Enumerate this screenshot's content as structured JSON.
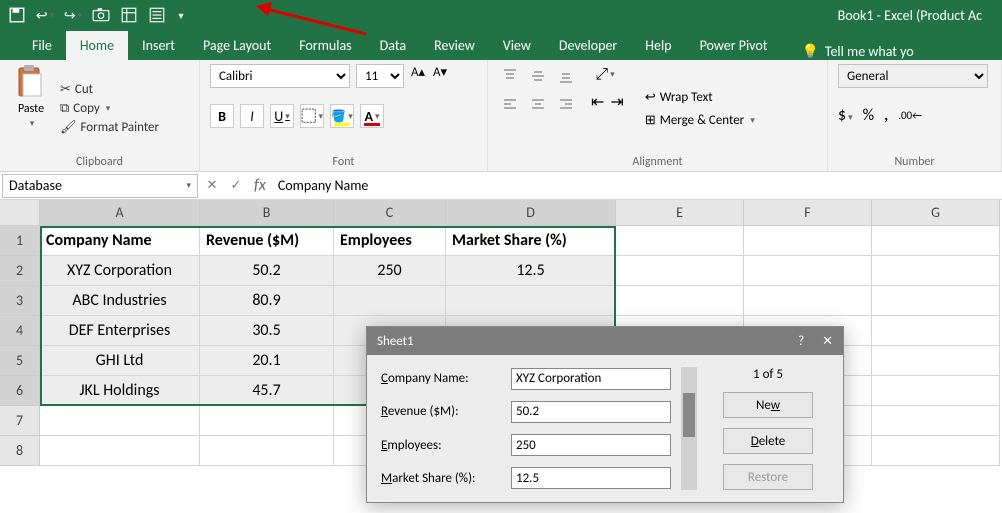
{
  "title": "Book1  -  Excel (Product Ac",
  "tabs": [
    "File",
    "Home",
    "Insert",
    "Page Layout",
    "Formulas",
    "Data",
    "Review",
    "View",
    "Developer",
    "Help",
    "Power Pivot"
  ],
  "tell_me": "Tell me what yo",
  "clipboard": {
    "cut": "Cut",
    "copy": "Copy",
    "fp": "Format Painter",
    "paste": "Paste",
    "label": "Clipboard"
  },
  "font": {
    "name": "Calibri",
    "size": "11",
    "label": "Font"
  },
  "alignment": {
    "wrap": "Wrap Text",
    "merge": "Merge & Center",
    "label": "Alignment"
  },
  "number": {
    "format": "General",
    "label": "Number"
  },
  "namebox": "Database",
  "formula": "Company Name",
  "columns": [
    "A",
    "B",
    "C",
    "D",
    "E",
    "F",
    "G"
  ],
  "rows": [
    "1",
    "2",
    "3",
    "4",
    "5",
    "6",
    "7",
    "8"
  ],
  "headers": [
    "Company Name",
    "Revenue ($M)",
    "Employees",
    "Market Share (%)"
  ],
  "data": [
    [
      "XYZ Corporation",
      "50.2",
      "250",
      "12.5"
    ],
    [
      "ABC Industries",
      "80.9",
      "",
      ""
    ],
    [
      "DEF Enterprises",
      "30.5",
      "",
      ""
    ],
    [
      "GHI Ltd",
      "20.1",
      "",
      ""
    ],
    [
      "JKL Holdings",
      "45.7",
      "",
      ""
    ]
  ],
  "form": {
    "title": "Sheet1",
    "counter": "1 of 5",
    "labels": {
      "a": "Company Name:",
      "b": "Revenue ($M):",
      "c": "Employees:",
      "d": "Market Share (%):"
    },
    "values": {
      "a": "XYZ Corporation",
      "b": "50.2",
      "c": "250",
      "d": "12.5"
    },
    "buttons": {
      "new": "New",
      "delete": "Delete",
      "restore": "Restore"
    }
  }
}
